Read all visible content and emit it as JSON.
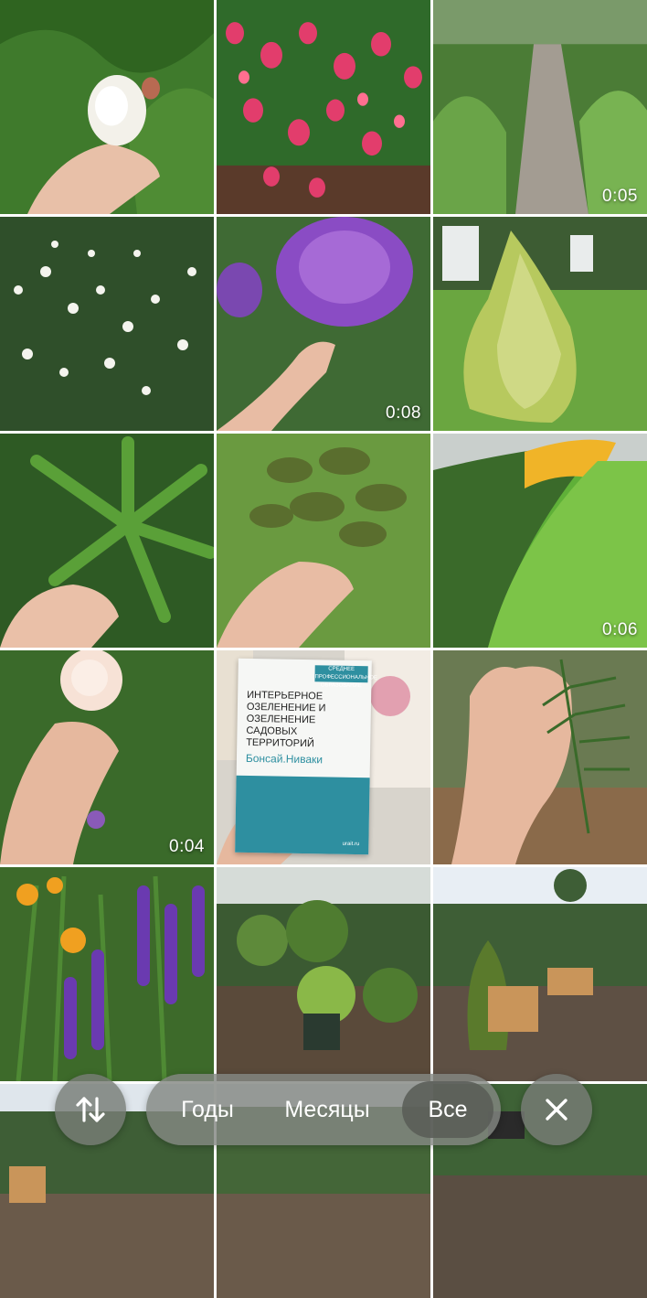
{
  "gallery": {
    "durations": {
      "t3": "0:05",
      "t5": "0:08",
      "t9": "0:06",
      "t10": "0:04"
    },
    "book": {
      "series_tag": "СРЕДНЕЕ ПРОФЕССИОНАЛЬНОЕ ОБРАЗОВАНИЕ",
      "title": "ИНТЕРЬЕРНОЕ ОЗЕЛЕНЕНИЕ И ОЗЕЛЕНЕНИЕ САДОВЫХ ТЕРРИТОРИЙ",
      "subtitle": "Бонсай.Ниваки",
      "publisher_url": "urait.ru"
    }
  },
  "toolbar": {
    "sort_icon": "swap-vertical-icon",
    "years_label": "Годы",
    "months_label": "Месяцы",
    "all_label": "Все",
    "close_icon": "close-icon"
  },
  "colors": {
    "toolbar_bg": "#84887f",
    "selected_segment": "#585c56",
    "book_accent": "#2e8fa0"
  }
}
